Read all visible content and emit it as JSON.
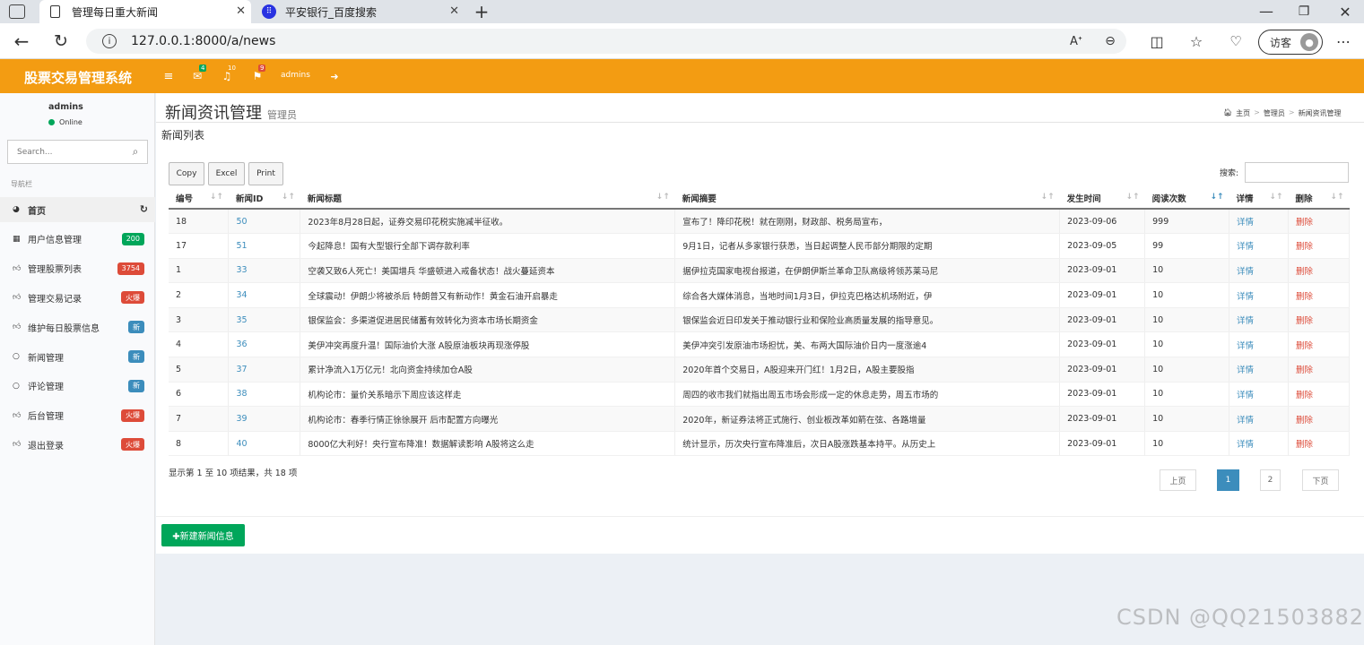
{
  "browser": {
    "tab1_title": "管理每日重大新闻",
    "tab2_title": "平安银行_百度搜索",
    "url": "127.0.0.1:8000/a/news",
    "profile_label": "访客"
  },
  "topbar": {
    "brand": "股票交易管理系统",
    "mail_count": "4",
    "bell_count": "10",
    "flag_count": "9",
    "username": "admins"
  },
  "sidebar": {
    "username": "admins",
    "status": "Online",
    "search_placeholder": "Search...",
    "nav_header": "导航栏",
    "items": [
      {
        "label": "首页",
        "badge": "",
        "icon": "dashboard-icon"
      },
      {
        "label": "用户信息管理",
        "badge": "200",
        "icon": "grid-icon"
      },
      {
        "label": "管理股票列表",
        "badge": "3754",
        "icon": "thumbs-up-icon"
      },
      {
        "label": "管理交易记录",
        "badge": "火爆",
        "icon": "thumbs-up-icon"
      },
      {
        "label": "维护每日股票信息",
        "badge": "新",
        "icon": "thumbs-up-icon"
      },
      {
        "label": "新闻管理",
        "badge": "新",
        "icon": "comment-icon"
      },
      {
        "label": "评论管理",
        "badge": "新",
        "icon": "comment-icon"
      },
      {
        "label": "后台管理",
        "badge": "火爆",
        "icon": "thumbs-up-icon"
      },
      {
        "label": "退出登录",
        "badge": "火爆",
        "icon": "thumbs-up-icon"
      }
    ]
  },
  "page": {
    "title": "新闻资讯管理",
    "subtitle": "管理员",
    "breadcrumb_home": "主页",
    "breadcrumb_admin": "管理员",
    "breadcrumb_current": "新闻资讯管理",
    "section_title": "新闻列表"
  },
  "toolbar": {
    "copy": "Copy",
    "excel": "Excel",
    "print": "Print",
    "search_label": "搜索:"
  },
  "table": {
    "headers": [
      "编号",
      "新闻ID",
      "新闻标题",
      "新闻摘要",
      "发生时间",
      "阅读次数",
      "详情",
      "删除"
    ],
    "rows": [
      [
        "18",
        "50",
        "2023年8月28日起，证券交易印花税实施减半征收。",
        "宣布了！降印花税！就在刚刚，财政部、税务局宣布，",
        "2023-09-06",
        "999",
        "详情",
        "删除"
      ],
      [
        "17",
        "51",
        "今起降息！国有大型银行全部下调存款利率",
        "9月1日，记者从多家银行获悉，当日起调整人民币部分期限的定期",
        "2023-09-05",
        "99",
        "详情",
        "删除"
      ],
      [
        "1",
        "33",
        "空袭又致6人死亡！美国增兵 华盛顿进入戒备状态！战火蔓延资本",
        "据伊拉克国家电视台报道，在伊朗伊斯兰革命卫队高级将领苏莱马尼",
        "2023-09-01",
        "10",
        "详情",
        "删除"
      ],
      [
        "2",
        "34",
        "全球震动！伊朗少将被杀后 特朗普又有新动作！黄金石油开启暴走",
        "综合各大媒体消息，当地时间1月3日，伊拉克巴格达机场附近，伊",
        "2023-09-01",
        "10",
        "详情",
        "删除"
      ],
      [
        "3",
        "35",
        "银保监会：多渠道促进居民储蓄有效转化为资本市场长期资金",
        "银保监会近日印发关于推动银行业和保险业高质量发展的指导意见。",
        "2023-09-01",
        "10",
        "详情",
        "删除"
      ],
      [
        "4",
        "36",
        "美伊冲突再度升温！国际油价大涨 A股原油板块再现涨停股",
        "美伊冲突引发原油市场担忧，美、布两大国际油价日内一度涨逾4",
        "2023-09-01",
        "10",
        "详情",
        "删除"
      ],
      [
        "5",
        "37",
        "累计净流入1万亿元！北向资金持续加仓A股",
        "2020年首个交易日，A股迎来开门红！1月2日，A股主要股指",
        "2023-09-01",
        "10",
        "详情",
        "删除"
      ],
      [
        "6",
        "38",
        "机构论市：量价关系暗示下周应该这样走",
        "周四的收市我们就指出周五市场会形成一定的休息走势，周五市场的",
        "2023-09-01",
        "10",
        "详情",
        "删除"
      ],
      [
        "7",
        "39",
        "机构论市：春季行情正徐徐展开 后市配置方向曝光",
        "2020年，新证券法将正式施行、创业板改革如箭在弦、各路增量",
        "2023-09-01",
        "10",
        "详情",
        "删除"
      ],
      [
        "8",
        "40",
        "8000亿大利好！央行宣布降准！数据解读影响 A股将这么走",
        "统计显示，历次央行宣布降准后，次日A股涨跌基本持平。从历史上",
        "2023-09-01",
        "10",
        "详情",
        "删除"
      ]
    ]
  },
  "footer": {
    "info": "显示第 1 至 10 项结果，共 18 项",
    "prev": "上页",
    "page1": "1",
    "page2": "2",
    "next": "下页",
    "new_button": "✚新建新闻信息"
  },
  "watermark": "CSDN @QQ21503882",
  "colors": {
    "brand": "#f39c12",
    "link": "#3c8dbc",
    "danger": "#dd4b39",
    "success": "#00a65a"
  }
}
